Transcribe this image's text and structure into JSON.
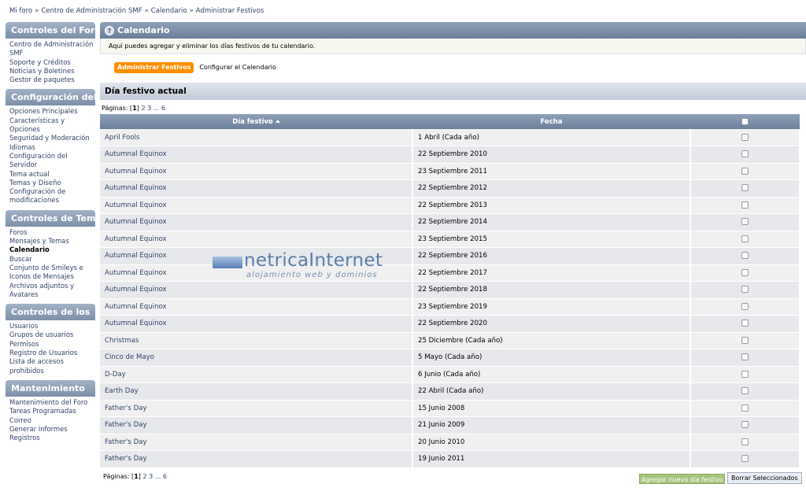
{
  "breadcrumb": [
    "Mi foro",
    "Centro de Administración SMF",
    "Calendario",
    "Administrar Festivos"
  ],
  "sidebar": [
    {
      "title": "Controles del Foro",
      "items": [
        "Centro de Administración",
        "SMF",
        "Soporte y Créditos",
        "Noticias y Boletines",
        "Gestor de paquetes"
      ]
    },
    {
      "title": "Configuración del",
      "items": [
        "Opciones Principales",
        "Características y Opciones",
        "Seguridad y Moderación",
        "Idiomas",
        "Configuración del Servidor",
        "Tema actual",
        "Temas y Diseño",
        "Configuración de",
        "modificaciones"
      ]
    },
    {
      "title": "Controles de Temas",
      "items": [
        "Foros",
        "Mensajes y Temas",
        "Calendario",
        "Buscar",
        "Conjunto de Smileys e",
        "Iconos de Mensajes",
        "Archivos adjuntos y Avatares"
      ],
      "active": "Calendario"
    },
    {
      "title": "Controles de los",
      "items": [
        "Usuarios",
        "Grupos de usuarios",
        "Permisos",
        "Registro de Usuarios",
        "Lista de accesos prohibidos"
      ]
    },
    {
      "title": "Mantenimiento",
      "items": [
        "Mantenimiento del Foro",
        "Tareas Programadas",
        "Correo",
        "Generar Informes",
        "Registros"
      ]
    }
  ],
  "main": {
    "section_title": "Calendario",
    "help_icon": "?",
    "description": "Aquí puedes agregar y eliminar los días festivos de tu calendario.",
    "tabs": {
      "active": "Administrar Festivos",
      "other": "Configurar el Calendario"
    },
    "title": "Día festivo actual",
    "pages_label": "Páginas:",
    "pages_current": "1",
    "pages_rest": "2 3 ... 6",
    "columns": {
      "name": "Día festivo",
      "date": "Fecha"
    },
    "rows": [
      {
        "name": "April Fools",
        "date": "1 Abril (Cada año)"
      },
      {
        "name": "Autumnal Equinox",
        "date": "22 Septiembre 2010"
      },
      {
        "name": "Autumnal Equinox",
        "date": "23 Septiembre 2011"
      },
      {
        "name": "Autumnal Equinox",
        "date": "22 Septiembre 2012"
      },
      {
        "name": "Autumnal Equinox",
        "date": "22 Septiembre 2013"
      },
      {
        "name": "Autumnal Equinox",
        "date": "22 Septiembre 2014"
      },
      {
        "name": "Autumnal Equinox",
        "date": "23 Septiembre 2015"
      },
      {
        "name": "Autumnal Equinox",
        "date": "22 Septiembre 2016"
      },
      {
        "name": "Autumnal Equinox",
        "date": "22 Septiembre 2017"
      },
      {
        "name": "Autumnal Equinox",
        "date": "22 Septiembre 2018"
      },
      {
        "name": "Autumnal Equinox",
        "date": "23 Septiembre 2019"
      },
      {
        "name": "Autumnal Equinox",
        "date": "22 Septiembre 2020"
      },
      {
        "name": "Christmas",
        "date": "25 Diciembre (Cada año)"
      },
      {
        "name": "Cinco de Mayo",
        "date": "5 Mayo (Cada año)"
      },
      {
        "name": "D-Day",
        "date": "6 Junio (Cada año)"
      },
      {
        "name": "Earth Day",
        "date": "22 Abril (Cada año)"
      },
      {
        "name": "Father's Day",
        "date": "15 Junio 2008"
      },
      {
        "name": "Father's Day",
        "date": "21 Junio 2009"
      },
      {
        "name": "Father's Day",
        "date": "20 Junio 2010"
      },
      {
        "name": "Father's Day",
        "date": "19 Junio 2011"
      }
    ],
    "buttons": {
      "add": "Agregar nuevo día festivo",
      "delete": "Borrar Seleccionados"
    }
  },
  "watermark": {
    "brand": "netricaInternet",
    "tagline": "alojamiento web y dominios"
  }
}
